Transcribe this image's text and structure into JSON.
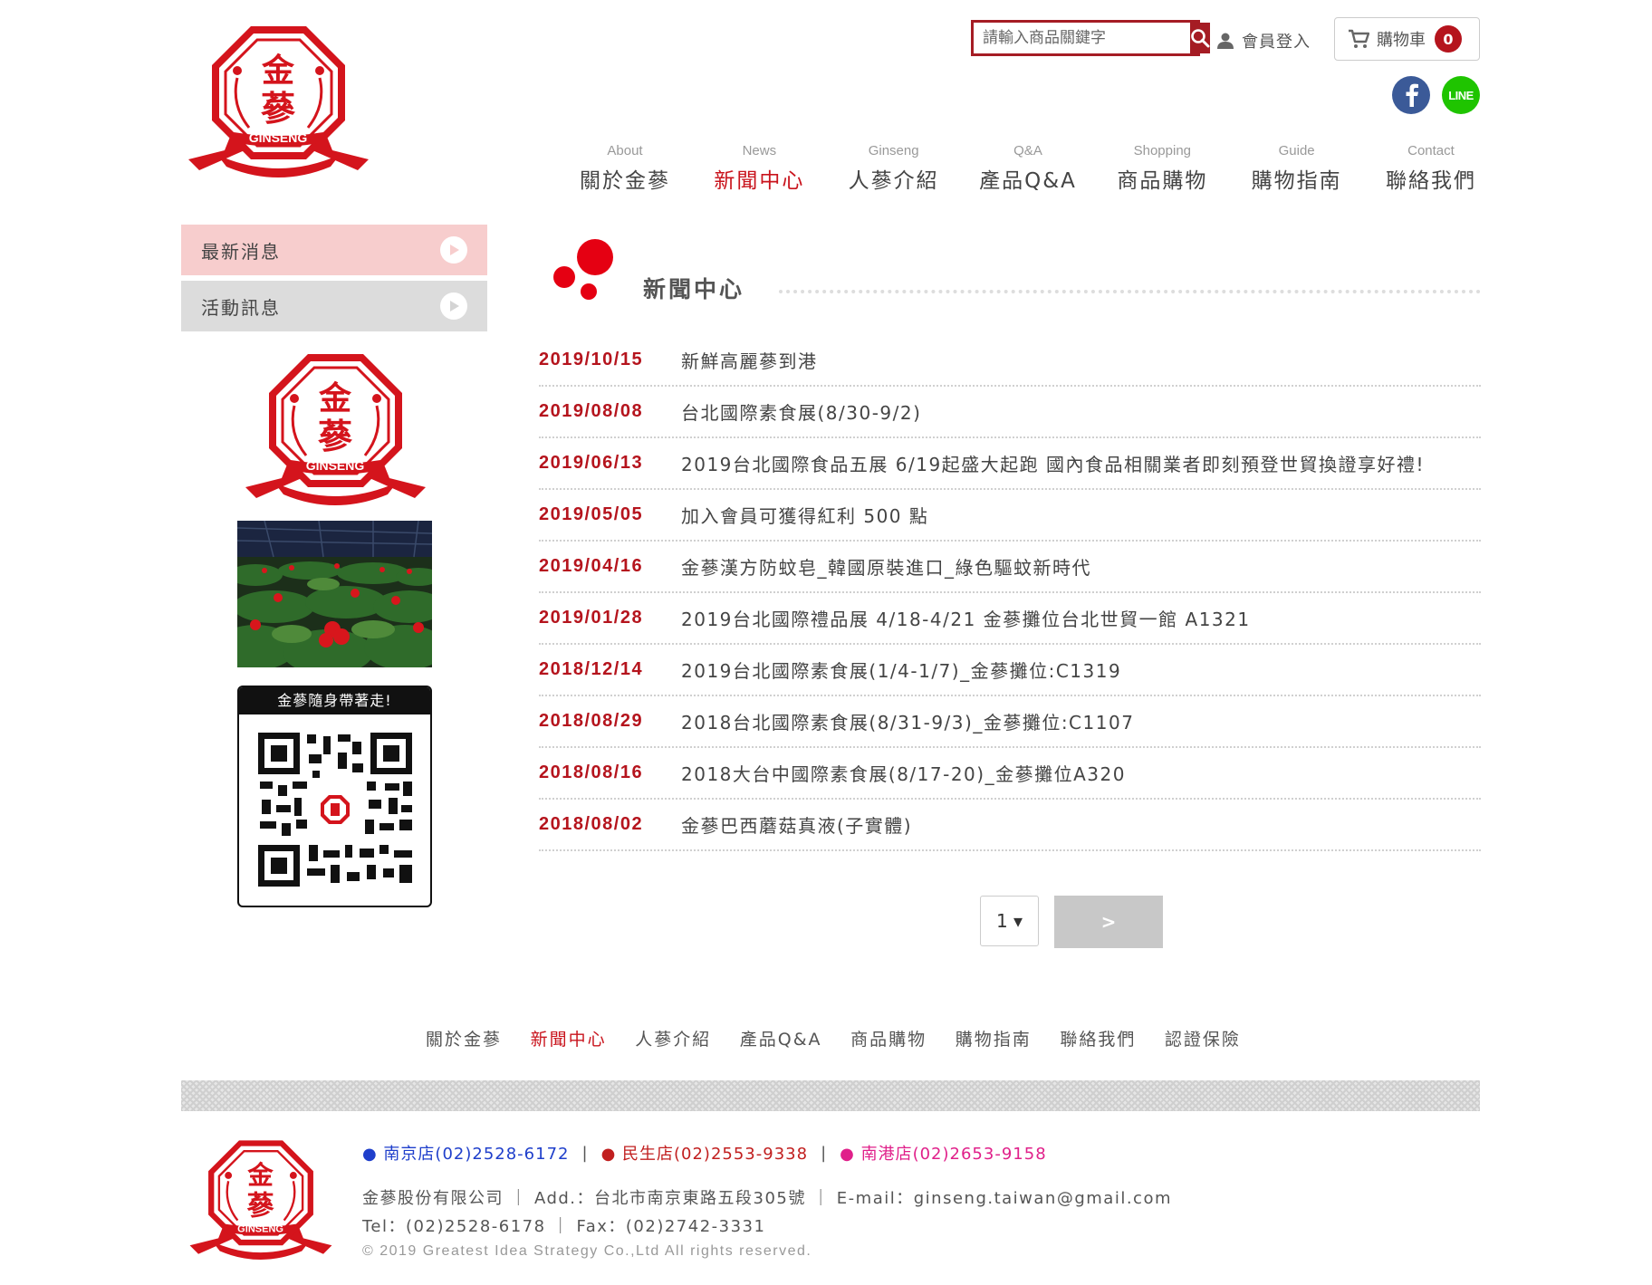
{
  "colors": {
    "brand_red": "#b5141d",
    "active_red": "#c9141d",
    "side_active": "#f7cdcd",
    "side_normal": "#dcdcdc"
  },
  "brand": {
    "logo_top": "金",
    "logo_mid": "蔘",
    "logo_text": "GINSENG"
  },
  "header": {
    "search_placeholder": "請輸入商品關鍵字",
    "login_label": "會員登入",
    "cart_label": "購物車",
    "cart_count": "0",
    "line_label": "LINE"
  },
  "nav": [
    {
      "en": "About",
      "zh": "關於金蔘"
    },
    {
      "en": "News",
      "zh": "新聞中心"
    },
    {
      "en": "Ginseng",
      "zh": "人蔘介紹"
    },
    {
      "en": "Q&A",
      "zh": "產品Q&A"
    },
    {
      "en": "Shopping",
      "zh": "商品購物"
    },
    {
      "en": "Guide",
      "zh": "購物指南"
    },
    {
      "en": "Contact",
      "zh": "聯絡我們"
    }
  ],
  "sidebar": {
    "items": [
      "最新消息",
      "活動訊息"
    ],
    "qr_title": "金蔘隨身帶著走!"
  },
  "main": {
    "section_title": "新聞中心",
    "news": [
      {
        "date": "2019/10/15",
        "title": "新鮮高麗蔘到港"
      },
      {
        "date": "2019/08/08",
        "title": "台北國際素食展(8/30-9/2)"
      },
      {
        "date": "2019/06/13",
        "title": "2019台北國際食品五展 6/19起盛大起跑 國內食品相關業者即刻預登世貿換證享好禮!"
      },
      {
        "date": "2019/05/05",
        "title": "加入會員可獲得紅利 500 點"
      },
      {
        "date": "2019/04/16",
        "title": "金蔘漢方防蚊皂_韓國原裝進口_綠色驅蚊新時代"
      },
      {
        "date": "2019/01/28",
        "title": "2019台北國際禮品展 4/18-4/21 金蔘攤位台北世貿一館 A1321"
      },
      {
        "date": "2018/12/14",
        "title": "2019台北國際素食展(1/4-1/7)_金蔘攤位:C1319"
      },
      {
        "date": "2018/08/29",
        "title": "2018台北國際素食展(8/31-9/3)_金蔘攤位:C1107"
      },
      {
        "date": "2018/08/16",
        "title": "2018大台中國際素食展(8/17-20)_金蔘攤位A320"
      },
      {
        "date": "2018/08/02",
        "title": "金蔘巴西蘑菇真液(子實體)"
      }
    ],
    "pager_value": "1 ▾",
    "pager_next": ">"
  },
  "footer": {
    "nav": [
      "關於金蔘",
      "新聞中心",
      "人蔘介紹",
      "產品Q&A",
      "商品購物",
      "購物指南",
      "聯絡我們",
      "認證保險"
    ],
    "stores": [
      "● 南京店(02)2528-6172",
      "● 民生店(02)2553-9338",
      "● 南港店(02)2653-9158"
    ],
    "store_sep": "|",
    "company": "金蔘股份有限公司 ｜ Add.：台北市南京東路五段305號 ｜ E-mail：ginseng.taiwan@gmail.com",
    "contact": "Tel：(02)2528-6178 ｜ Fax：(02)2742-3331",
    "copyright": "© 2019 Greatest Idea Strategy Co.,Ltd All rights reserved."
  }
}
